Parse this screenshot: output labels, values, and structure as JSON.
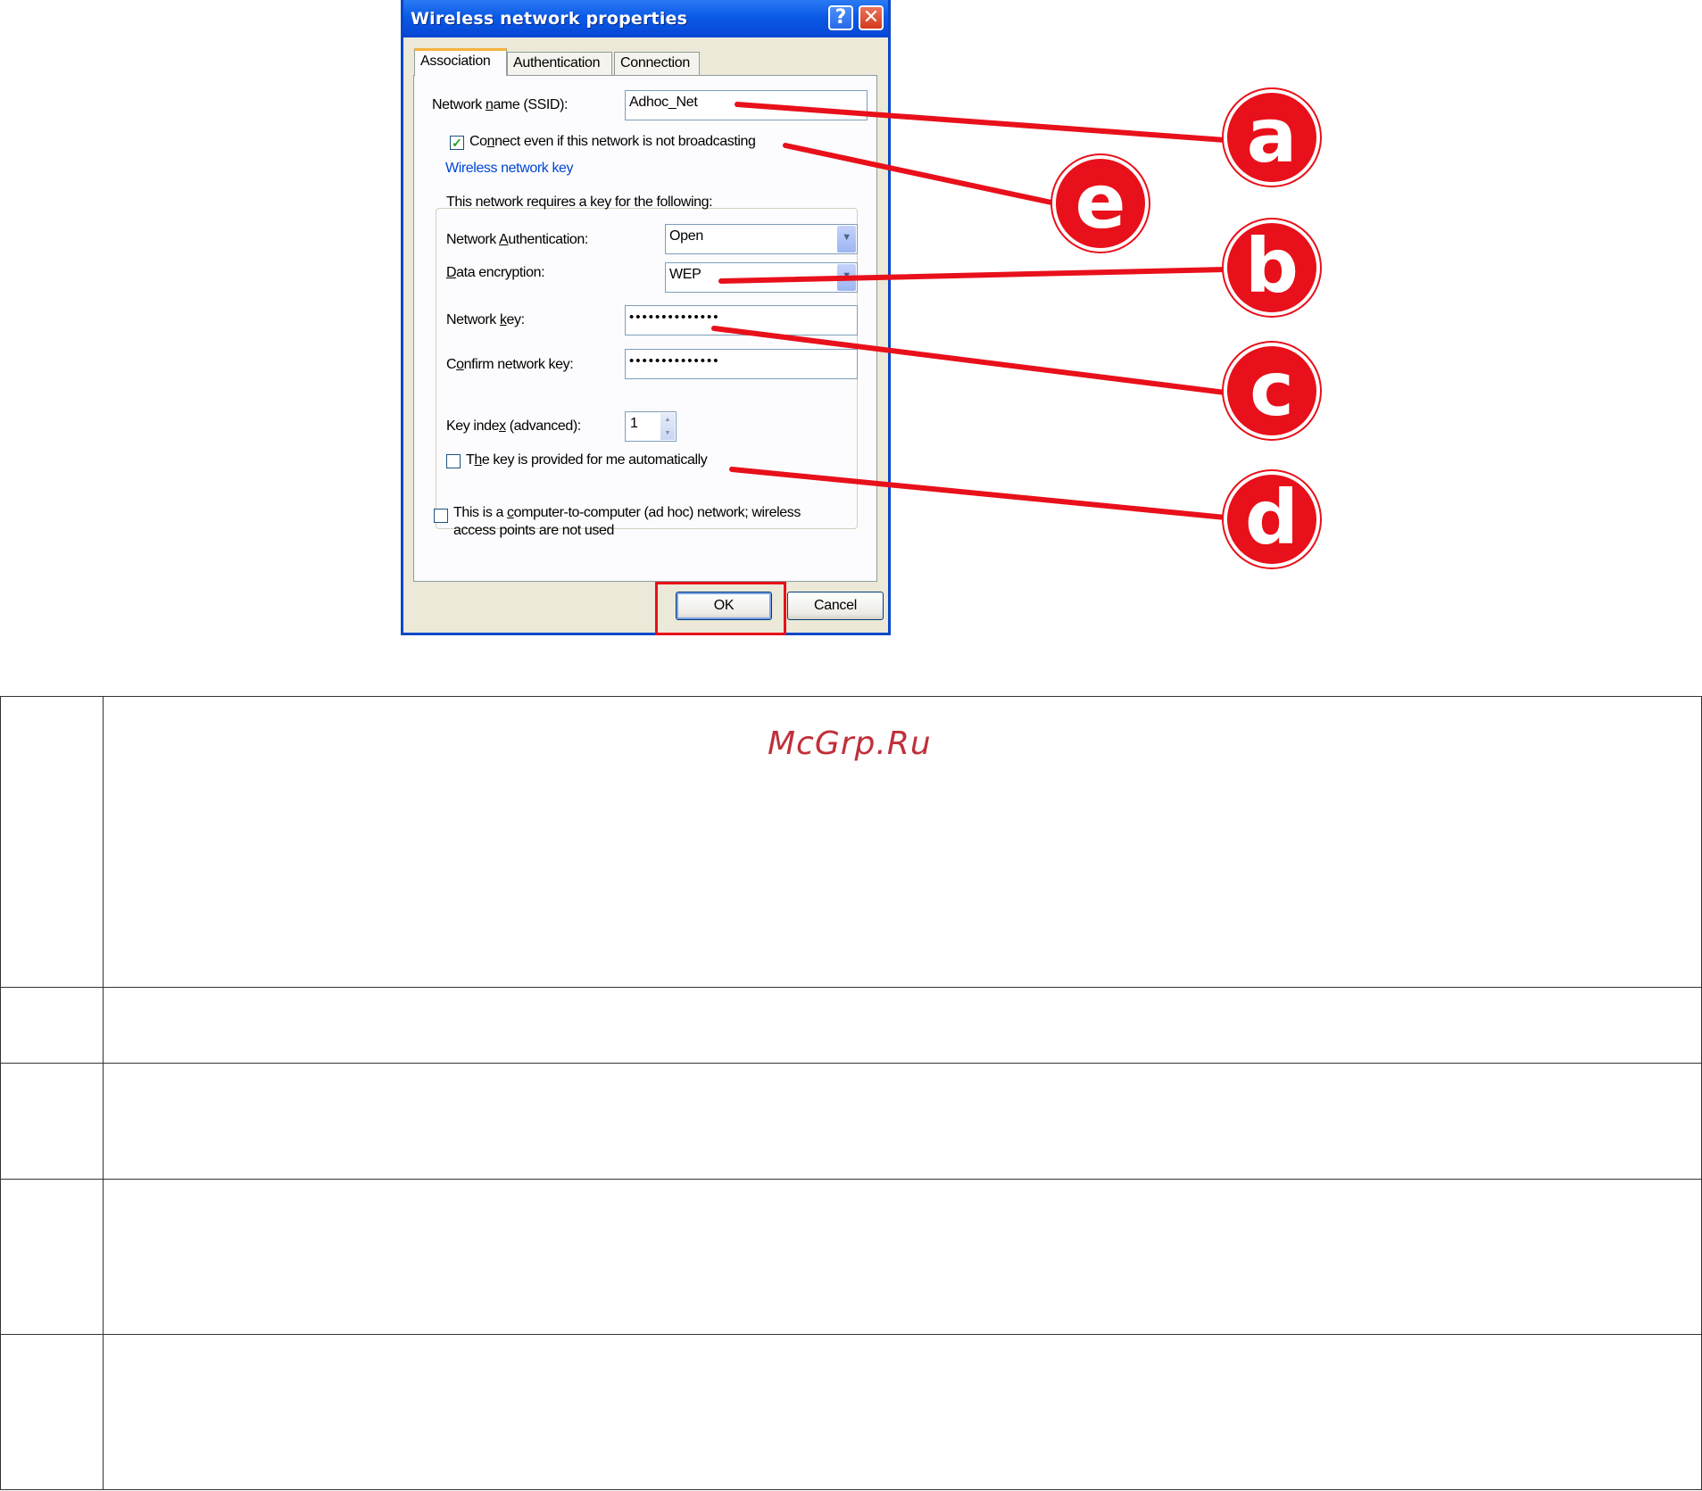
{
  "dialog": {
    "title": "Wireless network properties",
    "help_label": "?",
    "close_label": "✕",
    "tabs": [
      {
        "label": "Association",
        "active": true
      },
      {
        "label": "Authentication",
        "active": false
      },
      {
        "label": "Connection",
        "active": false
      }
    ],
    "ssid": {
      "label_pre": "Network ",
      "label_u": "n",
      "label_post": "ame (SSID):",
      "value": "Adhoc_Net"
    },
    "broadcast": {
      "checked": true,
      "label_pre": "Co",
      "label_u": "n",
      "label_post": "nect even if this network is not broadcasting"
    },
    "key_group": {
      "legend": "Wireless network key",
      "intro": "This network requires a key for the following:",
      "auth": {
        "label_pre": "Network ",
        "label_u": "A",
        "label_post": "uthentication:",
        "value": "Open"
      },
      "encryption": {
        "label_pre": "",
        "label_u": "D",
        "label_post": "ata encryption:",
        "value": "WEP"
      },
      "network_key": {
        "label_pre": "Network ",
        "label_u": "k",
        "label_post": "ey:",
        "value": "••••••••••••••"
      },
      "confirm_key": {
        "label_pre": "C",
        "label_u": "o",
        "label_post": "nfirm network key:",
        "value": "••••••••••••••"
      },
      "key_index": {
        "label_pre": "Key inde",
        "label_u": "x",
        "label_post": " (advanced):",
        "value": "1"
      },
      "auto_key": {
        "checked": false,
        "label_pre": "T",
        "label_u": "h",
        "label_post": "e key is provided for me automatically"
      }
    },
    "adhoc": {
      "checked": false,
      "line1_pre": "This is a ",
      "line1_u": "c",
      "line1_post": "omputer-to-computer (ad hoc) network; wireless",
      "line2": "access points are not used"
    },
    "ok_label": "OK",
    "cancel_label": "Cancel"
  },
  "callouts": [
    "a",
    "e",
    "b",
    "c",
    "d"
  ],
  "callout_color": "#e8101a",
  "watermark": "McGrp.Ru"
}
